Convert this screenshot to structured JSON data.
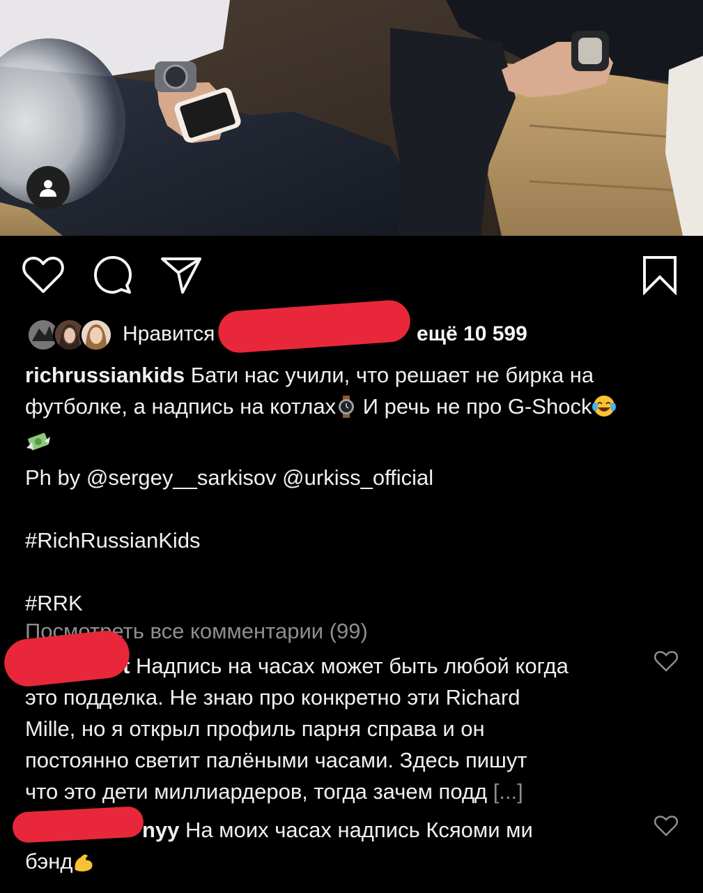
{
  "post": {
    "image_alt": "photo-two-men-seated-wearing-watches",
    "tag_icon": "person-icon"
  },
  "actions": {
    "like_icon": "heart-icon",
    "comment_icon": "comment-icon",
    "share_icon": "send-icon",
    "save_icon": "bookmark-icon"
  },
  "likes": {
    "prefix": "Нравится",
    "suffix": "ещё 10 599"
  },
  "caption": {
    "username": "richrussiankids",
    "line1": "Бати нас учили, что решает не бирка на",
    "line2a": "футболке, а надпись на котлах",
    "line2b": "И речь не про G-Shock",
    "line4": "Ph by @sergey__sarkisov @urkiss_official",
    "hashtag1": "#RichRussianKids",
    "hashtag2": "#RRK"
  },
  "comments": {
    "view_all": "Посмотреть все комментарии (99)",
    "items": [
      {
        "username_tail": "t",
        "line1": "Надпись на часах может быть любой когда",
        "line2": "это подделка. Не знаю про конкретно эти Richard",
        "line3": "Mille, но я открыл профиль парня справа и он",
        "line4": "постоянно светит палёными часами. Здесь пишут",
        "line5": "что это дети миллиардеров, тогда зачем подд",
        "more": "[...]",
        "heart_icon": "heart-outline-icon"
      },
      {
        "username_tail": "nyy",
        "line1": "На моих часах надпись Ксяоми ми",
        "line2": "бэнд",
        "heart_icon": "heart-outline-icon"
      }
    ]
  },
  "colors": {
    "background": "#000000",
    "text": "#f0f0f0",
    "muted": "#8e8e8e",
    "redaction": "#e8283a"
  }
}
